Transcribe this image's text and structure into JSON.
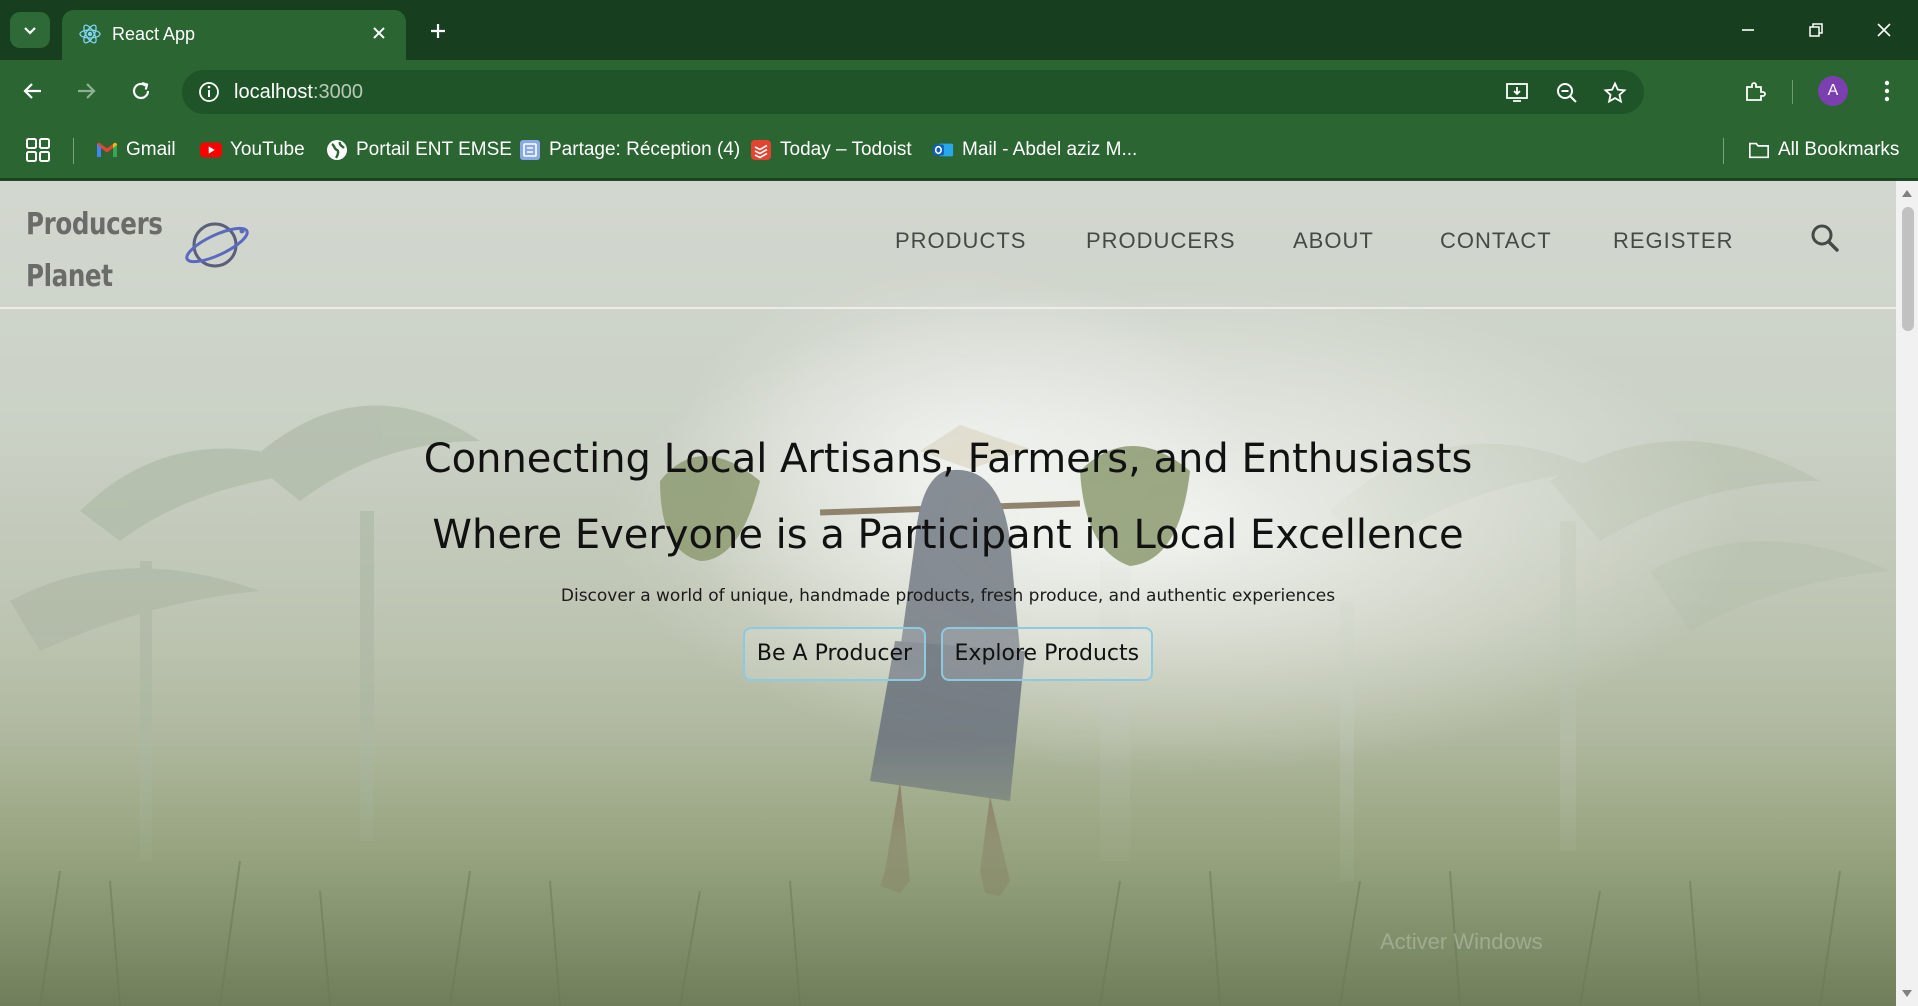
{
  "browser": {
    "tab": {
      "title": "React App",
      "favicon": "react-icon"
    },
    "omnibox": {
      "host": "localhost",
      "port": ":3000"
    },
    "bookmarks": [
      {
        "label": "Gmail",
        "icon": "gmail-icon"
      },
      {
        "label": "YouTube",
        "icon": "youtube-icon"
      },
      {
        "label": "Portail ENT EMSE",
        "icon": "globe-icon"
      },
      {
        "label": "Partage: Réception (4)",
        "icon": "zimbra-icon"
      },
      {
        "label": "Today – Todoist",
        "icon": "todoist-icon"
      },
      {
        "label": "Mail - Abdel aziz M...",
        "icon": "outlook-icon"
      }
    ],
    "all_bookmarks": "All Bookmarks",
    "profile_initial": "A",
    "colors": {
      "frame": "#173f1f",
      "toolbar": "#2a6532",
      "avatar": "#7b3fb0"
    }
  },
  "site": {
    "logo": {
      "line1": "Producers",
      "line2": "Planet",
      "icon": "planet-icon"
    },
    "nav": [
      "PRODUCTS",
      "PRODUCERS",
      "ABOUT",
      "CONTACT",
      "REGISTER"
    ],
    "hero": {
      "line1": "Connecting Local Artisans, Farmers, and Enthusiasts",
      "line2": "Where Everyone is a Participant in Local Excellence",
      "subtitle": "Discover a world of unique, handmade products, fresh produce, and authentic experiences",
      "buttons": {
        "producer": "Be A Producer",
        "explore": "Explore Products"
      }
    },
    "watermark": "Activer Windows",
    "colors": {
      "button_border": "#8ec9e0"
    }
  }
}
